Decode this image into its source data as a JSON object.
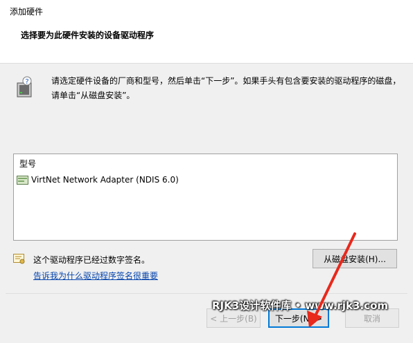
{
  "window": {
    "title": "添加硬件"
  },
  "header": {
    "subtitle": "选择要为此硬件安装的设备驱动程序"
  },
  "info": {
    "icon": "hardware-question-icon",
    "instruction": "请选定硬件设备的厂商和型号，然后单击“下一步”。如果手头有包含要安装的驱动程序的磁盘，请单击“从磁盘安装”。"
  },
  "model_list": {
    "header": "型号",
    "items": [
      {
        "icon": "network-adapter-icon",
        "label": "VirtNet Network Adapter (NDIS 6.0)"
      }
    ]
  },
  "signature": {
    "icon": "certificate-icon",
    "status": "这个驱动程序已经过数字签名。",
    "link": "告诉我为什么驱动程序签名很重要"
  },
  "buttons": {
    "have_disk": "从磁盘安装(H)...",
    "back": "< 上一步(B)",
    "next": "下一步(N) >",
    "cancel": "取消"
  },
  "watermark": "RJK3设计软件库 • www.rjk3.com",
  "colors": {
    "accent": "#0078d7",
    "link": "#0645ad",
    "arrow": "#e8291c"
  }
}
